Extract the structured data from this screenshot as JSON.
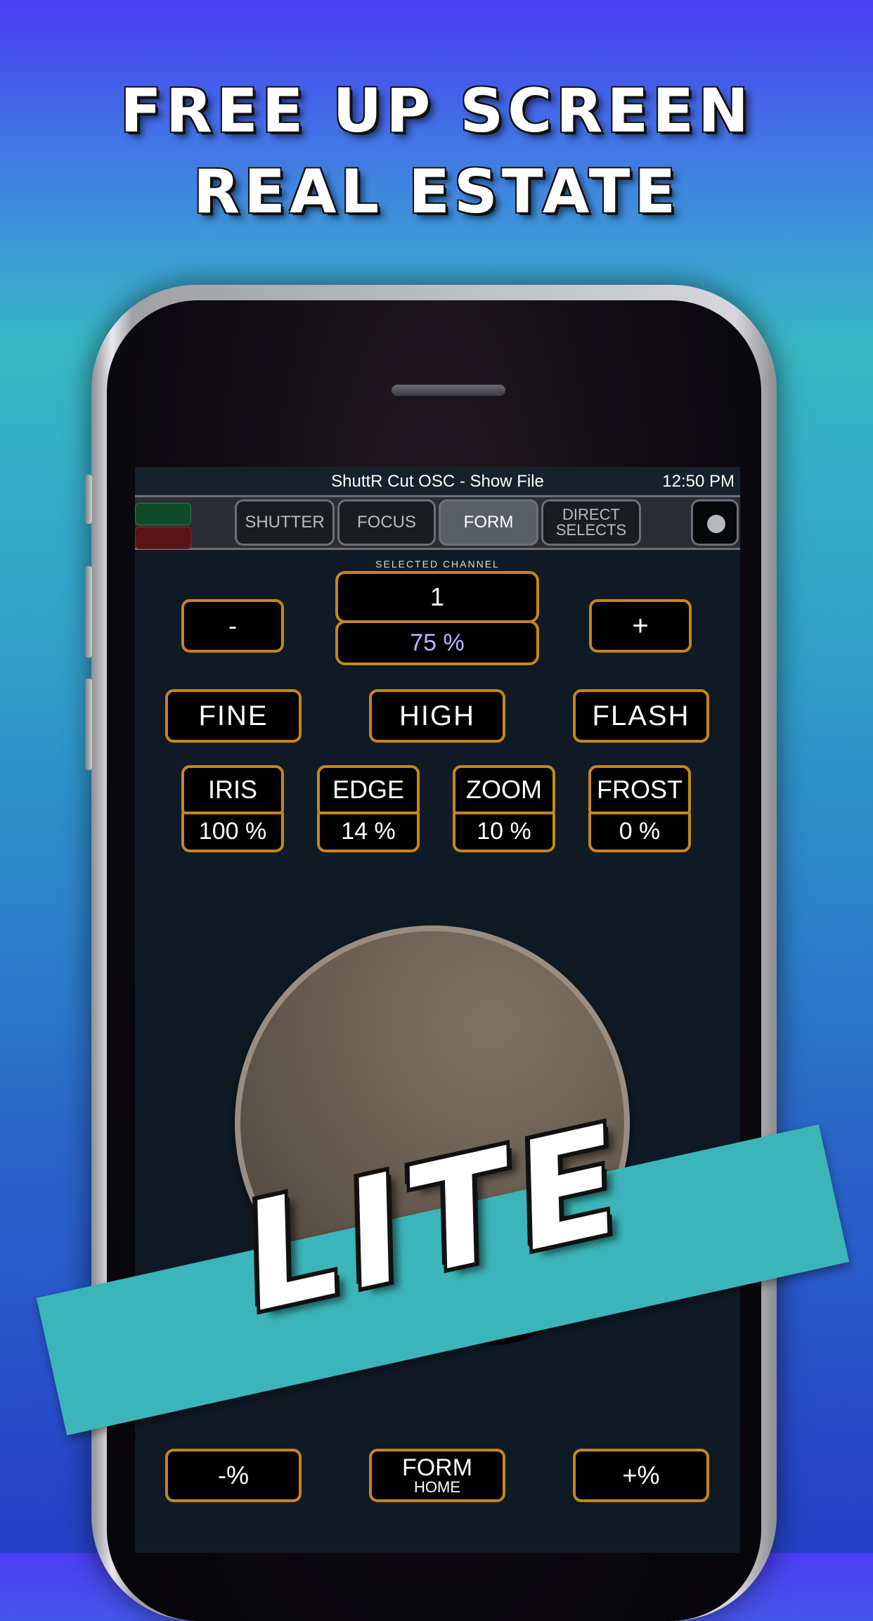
{
  "headline": {
    "line1": "FREE UP SCREEN",
    "line2": "REAL ESTATE"
  },
  "status_bar": {
    "title": "ShuttR Cut OSC - Show File",
    "time": "12:50 PM"
  },
  "tabs": [
    {
      "label": "SHUTTER",
      "active": false
    },
    {
      "label": "FOCUS",
      "active": false
    },
    {
      "label": "FORM",
      "active": true
    },
    {
      "label": "DIRECT\nSELECTS",
      "active": false
    }
  ],
  "selected_channel": {
    "label": "SELECTED CHANNEL",
    "number": "1",
    "level": "75 %"
  },
  "controls": {
    "minus_label": "-",
    "plus_label": "+"
  },
  "modes": {
    "fine": "FINE",
    "high": "HIGH",
    "flash": "FLASH"
  },
  "params": [
    {
      "name": "IRIS",
      "value": "100 %"
    },
    {
      "name": "EDGE",
      "value": "14 %"
    },
    {
      "name": "ZOOM",
      "value": "10 %"
    },
    {
      "name": "FROST",
      "value": "0 %"
    }
  ],
  "bottom_buttons": {
    "minus_pct": "-%",
    "form_label": "FORM",
    "form_sub": "HOME",
    "plus_pct": "+%"
  },
  "banner": {
    "text": "LITE",
    "color": "#3bb5b9"
  },
  "colors": {
    "accent_border": "#c4861e",
    "level_text": "#b9b3ff",
    "screen_bg": "#101a25"
  }
}
